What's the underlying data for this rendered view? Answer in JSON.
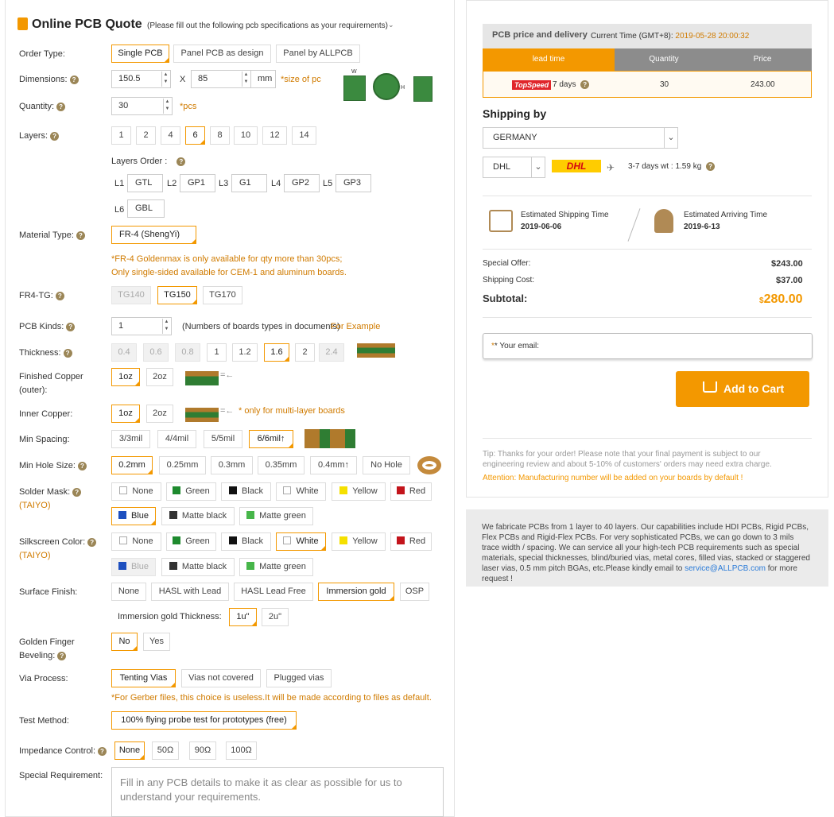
{
  "header": {
    "title": "Online PCB Quote",
    "subtitle": "(Please fill out the following pcb specifications as your requirements)"
  },
  "order_type": {
    "label": "Order Type:",
    "options": [
      "Single PCB",
      "Panel PCB as design",
      "Panel by ALLPCB"
    ]
  },
  "dimensions": {
    "label": "Dimensions:",
    "width": "150.5",
    "x": "X",
    "height": "85",
    "unit": "mm",
    "note": "*size of pc",
    "img_w": "W",
    "img_h": "H"
  },
  "quantity": {
    "label": "Quantity:",
    "value": "30",
    "unit": "*pcs"
  },
  "layers": {
    "label": "Layers:",
    "options": [
      "1",
      "2",
      "4",
      "6",
      "8",
      "10",
      "12",
      "14"
    ]
  },
  "layers_order": {
    "label": "Layers Order :",
    "items": [
      {
        "tag": "L1",
        "value": "GTL"
      },
      {
        "tag": "L2",
        "value": "GP1"
      },
      {
        "tag": "L3",
        "value": "G1"
      },
      {
        "tag": "L4",
        "value": "GP2"
      },
      {
        "tag": "L5",
        "value": "GP3"
      },
      {
        "tag": "L6",
        "value": "GBL"
      }
    ]
  },
  "material": {
    "label": "Material Type:",
    "value": "FR-4 (ShengYi)",
    "note1": "*FR-4 Goldenmax is only available for qty more than 30pcs;",
    "note2": "Only single-sided available for CEM-1 and aluminum boards."
  },
  "fr4tg": {
    "label": "FR4-TG:",
    "options": [
      "TG140",
      "TG150",
      "TG170"
    ]
  },
  "pcb_kinds": {
    "label": "PCB Kinds:",
    "value": "1",
    "note": "(Numbers of boards types in documents)",
    "example": "For Example"
  },
  "thickness": {
    "label": "Thickness:",
    "options": [
      "0.4",
      "0.6",
      "0.8",
      "1",
      "1.2",
      "1.6",
      "2",
      "2.4"
    ]
  },
  "finished_copper": {
    "label1": "Finished Copper",
    "label2": "(outer):",
    "options": [
      "1oz",
      "2oz"
    ]
  },
  "inner_copper": {
    "label": "Inner Copper:",
    "options": [
      "1oz",
      "2oz"
    ],
    "note": "* only for multi-layer boards"
  },
  "min_spacing": {
    "label": "Min Spacing:",
    "options": [
      "3/3mil",
      "4/4mil",
      "5/5mil",
      "6/6mil↑"
    ]
  },
  "min_hole": {
    "label": "Min Hole Size:",
    "options": [
      "0.2mm",
      "0.25mm",
      "0.3mm",
      "0.35mm",
      "0.4mm↑",
      "No Hole"
    ]
  },
  "solder_mask": {
    "label": "Solder Mask:",
    "sub": "(TAIYO)",
    "options": [
      {
        "name": "None",
        "color": "#ffffff"
      },
      {
        "name": "Green",
        "color": "#1e8a2e"
      },
      {
        "name": "Black",
        "color": "#111111"
      },
      {
        "name": "White",
        "color": "#ffffff"
      },
      {
        "name": "Yellow",
        "color": "#f5e000"
      },
      {
        "name": "Red",
        "color": "#c3141b"
      },
      {
        "name": "Blue",
        "color": "#1d4fbf"
      },
      {
        "name": "Matte black",
        "color": "#333333"
      },
      {
        "name": "Matte green",
        "color": "#47b64a"
      }
    ]
  },
  "silkscreen": {
    "label": "Silkscreen Color:",
    "sub": "(TAIYO)",
    "options": [
      {
        "name": "None",
        "color": "#ffffff"
      },
      {
        "name": "Green",
        "color": "#1e8a2e"
      },
      {
        "name": "Black",
        "color": "#111111"
      },
      {
        "name": "White",
        "color": "#ffffff"
      },
      {
        "name": "Yellow",
        "color": "#f5e000"
      },
      {
        "name": "Red",
        "color": "#c3141b"
      },
      {
        "name": "Blue",
        "color": "#1d4fbf"
      },
      {
        "name": "Matte black",
        "color": "#333333"
      },
      {
        "name": "Matte green",
        "color": "#47b64a"
      }
    ]
  },
  "surface": {
    "label": "Surface Finish:",
    "options": [
      "None",
      "HASL with Lead",
      "HASL Lead Free",
      "Immersion gold",
      "OSP"
    ],
    "thick_label": "Immersion gold Thickness:",
    "thick_options": [
      "1u\"",
      "2u\""
    ]
  },
  "golden_finger": {
    "label1": "Golden Finger",
    "label2": "Beveling:",
    "options": [
      "No",
      "Yes"
    ]
  },
  "via": {
    "label": "Via Process:",
    "options": [
      "Tenting Vias",
      "Vias not covered",
      "Plugged vias"
    ],
    "note": "*For Gerber files, this choice is useless.It will be made according to files as default."
  },
  "test": {
    "label": "Test Method:",
    "value": "100% flying probe test for prototypes (free)"
  },
  "impedance": {
    "label": "Impedance Control:",
    "options": [
      "None",
      "50Ω",
      "90Ω",
      "100Ω"
    ]
  },
  "special": {
    "label": "Special Requirement:",
    "placeholder": "Fill in any PCB details to make it as clear as possible for us to understand your requirements."
  },
  "price": {
    "title": "PCB price and delivery",
    "time_label": "Current Time (GMT+8):",
    "time_value": "2019-05-28 20:00:32",
    "col_lead": "lead time",
    "col_qty": "Quantity",
    "col_price": "Price",
    "badge": "TopSpeed",
    "lead": "7 days",
    "qty": "30",
    "amount": "243.00"
  },
  "shipping": {
    "title": "Shipping by",
    "country": "GERMANY",
    "carrier": "DHL",
    "logo": "DHL",
    "info": "3-7 days wt : 1.59 kg",
    "est_ship_label": "Estimated Shipping Time",
    "est_ship_date": "2019-06-06",
    "est_arr_label": "Estimated Arriving Time",
    "est_arr_date": "2019-6-13"
  },
  "summary": {
    "offer_label": "Special Offer:",
    "offer": "$243.00",
    "ship_label": "Shipping Cost:",
    "ship": "$37.00",
    "sub_label": "Subtotal:",
    "currency": "$",
    "sub": "280.00"
  },
  "email": {
    "label": "* Your email:"
  },
  "cart": {
    "label": "Add to Cart"
  },
  "tip": {
    "text": "Tip: Thanks for your order! Please note that your final payment is subject to our engineering review and about 5-10% of customers' orders may need extra charge.",
    "attention": "Attention: Manufacturing number will be added on your boards by default !"
  },
  "info": {
    "text": "We fabricate PCBs from 1 layer to 40 layers. Our capabilities include HDI PCBs, Rigid PCBs, Flex PCBs and Rigid-Flex PCBs. For very sophisticated PCBs, we can go down to 3 mils trace width / spacing. We can service all your high-tech PCB requirements such as special materials, special thicknesses, blind/buried vias, metal cores, filled vias, stacked or staggered laser vias, 0.5 mm pitch BGAs, etc.Please kindly email to",
    "email": "service@ALLPCB.com",
    "tail": "for more request !"
  }
}
